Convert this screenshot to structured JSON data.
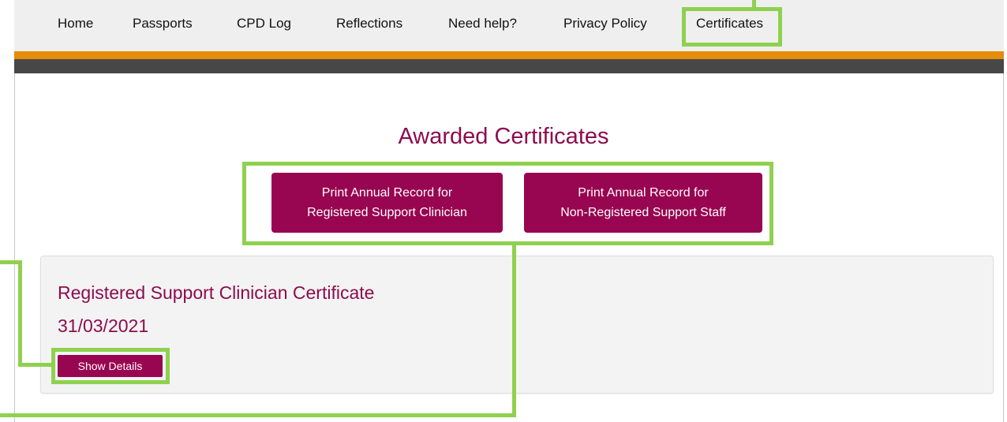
{
  "nav": {
    "items": [
      {
        "label": "Home"
      },
      {
        "label": "Passports"
      },
      {
        "label": "CPD Log"
      },
      {
        "label": "Reflections"
      },
      {
        "label": "Need help?"
      },
      {
        "label": "Privacy Policy"
      },
      {
        "label": "Certificates"
      }
    ]
  },
  "main": {
    "title": "Awarded Certificates",
    "print_buttons": [
      {
        "line1": "Print Annual Record for",
        "line2": "Registered Support Clinician"
      },
      {
        "line1": "Print Annual Record for",
        "line2": "Non-Registered Support Staff"
      }
    ]
  },
  "certificate": {
    "title": "Registered Support Clinician Certificate",
    "date": "31/03/2021",
    "show_details_label": "Show Details"
  },
  "colors": {
    "brand": "#8c0c4f",
    "button": "#980550",
    "stripe_orange": "#e58c0a",
    "stripe_dark": "#474747",
    "highlight": "#8fd14f"
  }
}
